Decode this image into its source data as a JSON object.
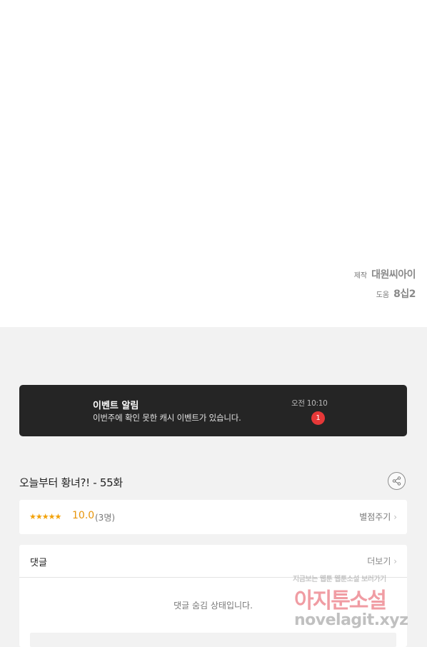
{
  "credits": [
    {
      "role": "제작",
      "value": "대원씨아이"
    },
    {
      "role": "도움",
      "value": "8십2"
    }
  ],
  "event": {
    "title": "이벤트 알림",
    "description": "이번주에 확인 못한 캐시 이벤트가 있습니다.",
    "time": "오전 10:10",
    "badge_count": "1"
  },
  "episode": {
    "title": "오늘부터 황녀?! - 55화",
    "share_icon": "share-icon"
  },
  "rating": {
    "stars": "★★★★★",
    "score": "10.0",
    "count": "(3명)",
    "rate_link": "별점주기"
  },
  "comments": {
    "title": "댓글",
    "more_link": "더보기",
    "hidden_message": "댓글 숨김 상태입니다."
  },
  "watermark": {
    "tagline": "지금보는 웹툰 웹툰소설 보러가기",
    "brand": "아지툰소설",
    "url": "novelagit.xyz"
  },
  "colors": {
    "banner_bg": "#252525",
    "badge": "#e63838",
    "star": "#f2a20a",
    "page_bg": "#f2f2f2"
  }
}
